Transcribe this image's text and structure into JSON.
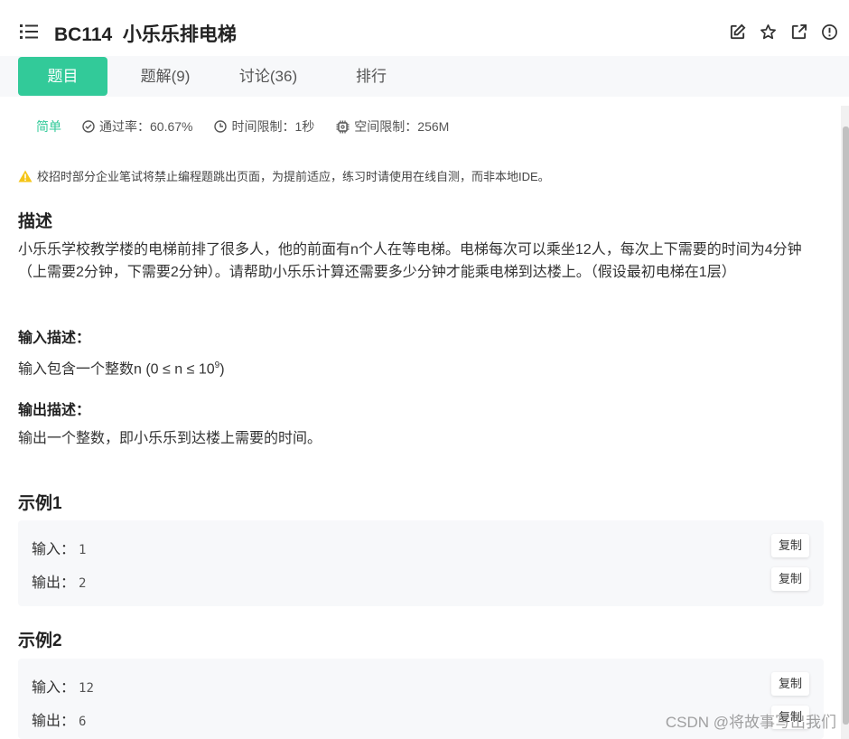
{
  "header": {
    "title": "BC114  小乐乐排电梯",
    "icons": [
      "menu-list-icon",
      "edit-icon",
      "star-icon",
      "external-link-icon",
      "info-icon"
    ]
  },
  "tabs": [
    {
      "label": "题目",
      "active": true
    },
    {
      "label": "题解(9)",
      "active": false
    },
    {
      "label": "讨论(36)",
      "active": false
    },
    {
      "label": "排行",
      "active": false
    }
  ],
  "meta": {
    "difficulty": "简单",
    "pass_rate": "通过率：60.67%",
    "time_limit": "时间限制：1秒",
    "space_limit": "空间限制：256M"
  },
  "notice": "校招时部分企业笔试将禁止编程题跳出页面，为提前适应，练习时请使用在线自测，而非本地IDE。",
  "description": {
    "heading": "描述",
    "text": "小乐乐学校教学楼的电梯前排了很多人，他的前面有n个人在等电梯。电梯每次可以乘坐12人，每次上下需要的时间为4分钟（上需要2分钟，下需要2分钟）。请帮助小乐乐计算还需要多少分钟才能乘电梯到达楼上。（假设最初电梯在1层）"
  },
  "input_desc": {
    "heading": "输入描述：",
    "text": "输入包含一个整数n (0 ≤ n ≤ 10",
    "sup": "9",
    "text_end": ")"
  },
  "output_desc": {
    "heading": "输出描述：",
    "text": "输出一个整数，即小乐乐到达楼上需要的时间。"
  },
  "examples": [
    {
      "title": "示例1",
      "input_label": "输入：",
      "input": "1",
      "output_label": "输出：",
      "output": "2",
      "copy": "复制"
    },
    {
      "title": "示例2",
      "input_label": "输入：",
      "input": "12",
      "output_label": "输出：",
      "output": "6",
      "copy": "复制"
    }
  ],
  "watermark": "CSDN @将故事写出我们",
  "colors": {
    "accent": "#32ca99",
    "panel_bg": "#f7f8fa",
    "warning": "#f5c518"
  }
}
